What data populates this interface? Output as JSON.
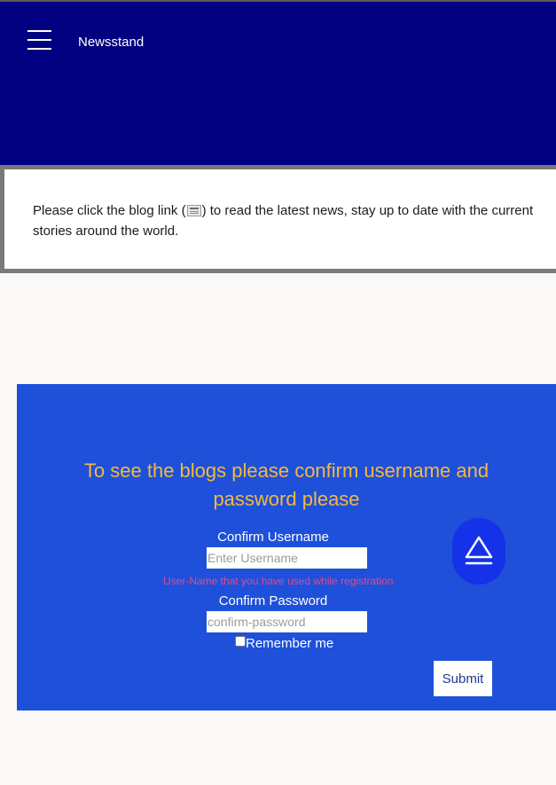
{
  "header": {
    "title": "Newsstand",
    "menu_icon": "hamburger-menu-icon"
  },
  "notice": {
    "text_before": "Please click the blog link (",
    "text_after": ") to read the latest news, stay up to date with the current stories around the world.",
    "icon": "blog-link-icon"
  },
  "form": {
    "heading": "To see the blogs please confirm username and password please",
    "username_label": "Confirm Username",
    "username_placeholder": "Enter Username",
    "username_value": "",
    "username_helper": "User-Name that you have used while registration.",
    "password_label": "Confirm Password",
    "password_placeholder": "confirm-password",
    "password_value": "",
    "remember_label": "Remember me",
    "remember_checked": false,
    "submit_label": "Submit",
    "fab_icon": "eject-icon"
  },
  "colors": {
    "header_bg": "#000080",
    "panel_bg": "#1e50d9",
    "heading": "#f5b83d",
    "helper": "#e8478b",
    "fab_bg": "#1532e8"
  }
}
